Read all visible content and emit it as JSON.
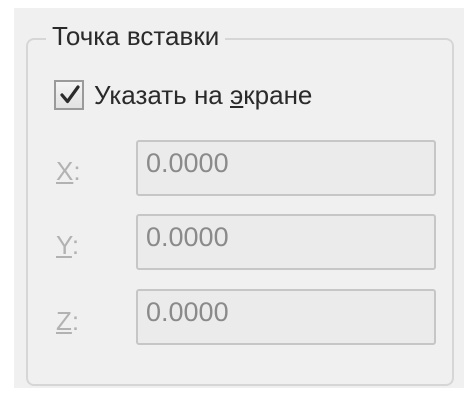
{
  "insertion_point": {
    "title": "Точка вставки",
    "specify_on_screen": {
      "checked": true,
      "label_before": "Указать на ",
      "label_mnemonic": "э",
      "label_after": "кране"
    },
    "coords": [
      {
        "label": "X",
        "suffix": ":",
        "value": "0.0000"
      },
      {
        "label": "Y",
        "suffix": ":",
        "value": "0.0000"
      },
      {
        "label": "Z",
        "suffix": ":",
        "value": "0.0000"
      }
    ]
  },
  "colors": {
    "panel_bg": "#f0f0f0",
    "disabled_text": "#b2b2b2",
    "field_text": "#8a8a8a",
    "check_mark": "#2b2b2b"
  },
  "icons": {
    "checkbox": "checkmark-icon"
  }
}
